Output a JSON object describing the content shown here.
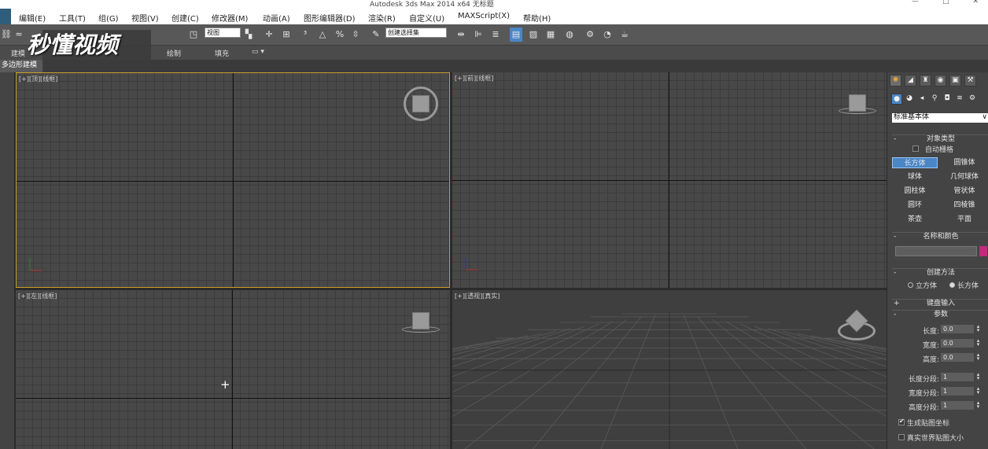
{
  "window": {
    "title": "Autodesk 3ds Max  2014 x64     无标题",
    "controls": [
      "—",
      "□",
      "✕"
    ]
  },
  "menu": [
    "编辑(E)",
    "工具(T)",
    "组(G)",
    "视图(V)",
    "创建(C)",
    "修改器(M)",
    "动画(A)",
    "图形编辑器(D)",
    "渲染(R)",
    "自定义(U)",
    "MAXScript(X)",
    "帮助(H)"
  ],
  "toolbar": {
    "view_select": "视图",
    "selection_set": "创建选择集"
  },
  "watermark": "秒懂视频",
  "ribbon": {
    "tabs": [
      "建模",
      "绘制",
      "填充"
    ],
    "active_subtab": "多边形建模"
  },
  "viewports": {
    "top": "[+][顶][线框]",
    "front": "[+][前][线框]",
    "left": "[+][左][线框]",
    "perspective": "[+][透视][真实]"
  },
  "command_panel": {
    "category": "标准基本体",
    "object_type": {
      "title": "对象类型",
      "autogrid": "自动栅格",
      "buttons": [
        "长方体",
        "圆锥体",
        "球体",
        "几何球体",
        "圆柱体",
        "管状体",
        "圆环",
        "四棱锥",
        "茶壶",
        "平面"
      ],
      "selected": "长方体"
    },
    "name_color": {
      "title": "名称和颜色",
      "color": "#c02b7b"
    },
    "creation_method": {
      "title": "创建方法",
      "options": [
        "立方体",
        "长方体"
      ],
      "selected": "长方体"
    },
    "keyboard_entry": "键盘输入",
    "parameters": {
      "title": "参数",
      "fields": [
        {
          "label": "长度:",
          "value": "0.0"
        },
        {
          "label": "宽度:",
          "value": "0.0"
        },
        {
          "label": "高度:",
          "value": "0.0"
        }
      ],
      "segments": [
        {
          "label": "长度分段:",
          "value": "1"
        },
        {
          "label": "宽度分段:",
          "value": "1"
        },
        {
          "label": "高度分段:",
          "value": "1"
        }
      ],
      "gen_map_coords": "生成贴图坐标",
      "real_world_map": "真实世界贴图大小"
    }
  }
}
